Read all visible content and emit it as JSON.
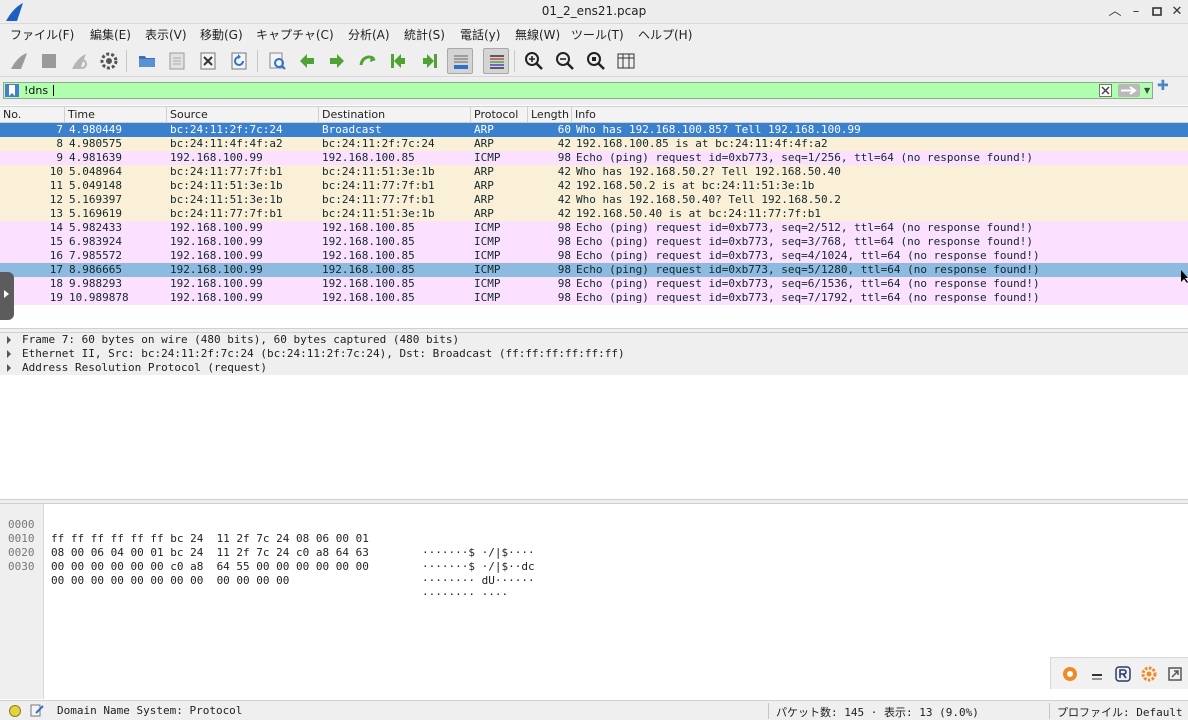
{
  "window": {
    "title": "01_2_ens21.pcap",
    "accent_color": "#2f6fce",
    "controls": [
      "chevron-up-icon",
      "minimize-icon",
      "maximize-icon",
      "close-icon"
    ]
  },
  "menu": [
    "ファイル(F)",
    "編集(E)",
    "表示(V)",
    "移動(G)",
    "キャプチャ(C)",
    "分析(A)",
    "統計(S)",
    "電話(y)",
    "無線(W)",
    "ツール(T)",
    "ヘルプ(H)"
  ],
  "filter": {
    "value": "!dns",
    "color": "#afffaf"
  },
  "packet_list": {
    "columns": [
      "No.",
      "Time",
      "Source",
      "Destination",
      "Protocol",
      "Length",
      "Info"
    ],
    "colors": {
      "arp": "#faf0d7",
      "icmp": "#fce0ff",
      "selected": "#3a80cd",
      "marked": "#8dbbdf"
    },
    "rows": [
      {
        "no": "7",
        "time": "4.980449",
        "src": "bc:24:11:2f:7c:24",
        "dst": "Broadcast",
        "proto": "ARP",
        "len": "60",
        "info": "Who has 192.168.100.85? Tell 192.168.100.99",
        "state": "selected"
      },
      {
        "no": "8",
        "time": "4.980575",
        "src": "bc:24:11:4f:4f:a2",
        "dst": "bc:24:11:2f:7c:24",
        "proto": "ARP",
        "len": "42",
        "info": "192.168.100.85 is at bc:24:11:4f:4f:a2",
        "state": "arp"
      },
      {
        "no": "9",
        "time": "4.981639",
        "src": "192.168.100.99",
        "dst": "192.168.100.85",
        "proto": "ICMP",
        "len": "98",
        "info": "Echo (ping) request  id=0xb773, seq=1/256, ttl=64 (no response found!)",
        "state": "icmp"
      },
      {
        "no": "10",
        "time": "5.048964",
        "src": "bc:24:11:77:7f:b1",
        "dst": "bc:24:11:51:3e:1b",
        "proto": "ARP",
        "len": "42",
        "info": "Who has 192.168.50.2? Tell 192.168.50.40",
        "state": "arp"
      },
      {
        "no": "11",
        "time": "5.049148",
        "src": "bc:24:11:51:3e:1b",
        "dst": "bc:24:11:77:7f:b1",
        "proto": "ARP",
        "len": "42",
        "info": "192.168.50.2 is at bc:24:11:51:3e:1b",
        "state": "arp"
      },
      {
        "no": "12",
        "time": "5.169397",
        "src": "bc:24:11:51:3e:1b",
        "dst": "bc:24:11:77:7f:b1",
        "proto": "ARP",
        "len": "42",
        "info": "Who has 192.168.50.40? Tell 192.168.50.2",
        "state": "arp"
      },
      {
        "no": "13",
        "time": "5.169619",
        "src": "bc:24:11:77:7f:b1",
        "dst": "bc:24:11:51:3e:1b",
        "proto": "ARP",
        "len": "42",
        "info": "192.168.50.40 is at bc:24:11:77:7f:b1",
        "state": "arp"
      },
      {
        "no": "14",
        "time": "5.982433",
        "src": "192.168.100.99",
        "dst": "192.168.100.85",
        "proto": "ICMP",
        "len": "98",
        "info": "Echo (ping) request  id=0xb773, seq=2/512, ttl=64 (no response found!)",
        "state": "icmp"
      },
      {
        "no": "15",
        "time": "6.983924",
        "src": "192.168.100.99",
        "dst": "192.168.100.85",
        "proto": "ICMP",
        "len": "98",
        "info": "Echo (ping) request  id=0xb773, seq=3/768, ttl=64 (no response found!)",
        "state": "icmp"
      },
      {
        "no": "16",
        "time": "7.985572",
        "src": "192.168.100.99",
        "dst": "192.168.100.85",
        "proto": "ICMP",
        "len": "98",
        "info": "Echo (ping) request  id=0xb773, seq=4/1024, ttl=64 (no response found!)",
        "state": "icmp"
      },
      {
        "no": "17",
        "time": "8.986665",
        "src": "192.168.100.99",
        "dst": "192.168.100.85",
        "proto": "ICMP",
        "len": "98",
        "info": "Echo (ping) request  id=0xb773, seq=5/1280, ttl=64 (no response found!)",
        "state": "marked"
      },
      {
        "no": "18",
        "time": "9.988293",
        "src": "192.168.100.99",
        "dst": "192.168.100.85",
        "proto": "ICMP",
        "len": "98",
        "info": "Echo (ping) request  id=0xb773, seq=6/1536, ttl=64 (no response found!)",
        "state": "icmp"
      },
      {
        "no": "19",
        "time": "10.989878",
        "src": "192.168.100.99",
        "dst": "192.168.100.85",
        "proto": "ICMP",
        "len": "98",
        "info": "Echo (ping) request  id=0xb773, seq=7/1792, ttl=64 (no response found!)",
        "state": "icmp"
      }
    ]
  },
  "details": [
    "Frame 7: 60 bytes on wire (480 bits), 60 bytes captured (480 bits)",
    "Ethernet II, Src: bc:24:11:2f:7c:24 (bc:24:11:2f:7c:24), Dst: Broadcast (ff:ff:ff:ff:ff:ff)",
    "Address Resolution Protocol (request)"
  ],
  "bytes": [
    {
      "offset": "0000",
      "hex": "ff ff ff ff ff ff bc 24  11 2f 7c 24 08 06 00 01",
      "ascii": "·······$ ·/|$····"
    },
    {
      "offset": "0010",
      "hex": "08 00 06 04 00 01 bc 24  11 2f 7c 24 c0 a8 64 63",
      "ascii": "·······$ ·/|$··dc"
    },
    {
      "offset": "0020",
      "hex": "00 00 00 00 00 00 c0 a8  64 55 00 00 00 00 00 00",
      "ascii": "········ dU······"
    },
    {
      "offset": "0030",
      "hex": "00 00 00 00 00 00 00 00  00 00 00 00",
      "ascii": "········ ····"
    }
  ],
  "status": {
    "field_info": "Domain Name System: Protocol",
    "packets": "パケット数: 145 · 表示: 13 (9.0%)",
    "profile": "プロファイル: Default"
  }
}
